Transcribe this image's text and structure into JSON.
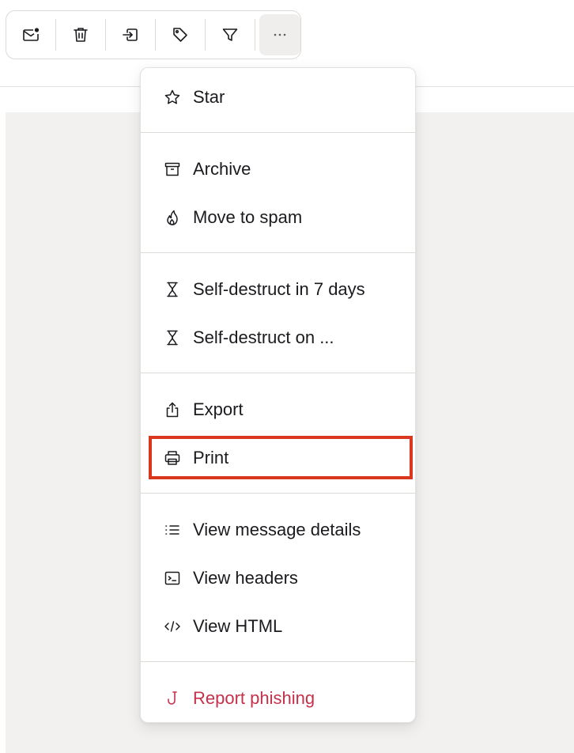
{
  "toolbar": {
    "buttons": [
      {
        "icon": "mark-unread-icon"
      },
      {
        "icon": "trash-icon"
      },
      {
        "icon": "move-to-folder-icon"
      },
      {
        "icon": "label-tag-icon"
      },
      {
        "icon": "filter-icon"
      },
      {
        "icon": "more-options-icon",
        "label": "···"
      }
    ]
  },
  "menu": {
    "items": {
      "star": "Star",
      "archive": "Archive",
      "move_to_spam": "Move to spam",
      "self_destruct_7": "Self-destruct in 7 days",
      "self_destruct_on": "Self-destruct on ...",
      "export": "Export",
      "print": "Print",
      "view_details": "View message details",
      "view_headers": "View headers",
      "view_html": "View HTML",
      "report_phishing": "Report phishing"
    },
    "highlighted_item": "print"
  },
  "colors": {
    "danger": "#c5304b",
    "highlight": "#d9381e",
    "content_bg": "#f2f1ef",
    "text": "#1b1b1f"
  }
}
